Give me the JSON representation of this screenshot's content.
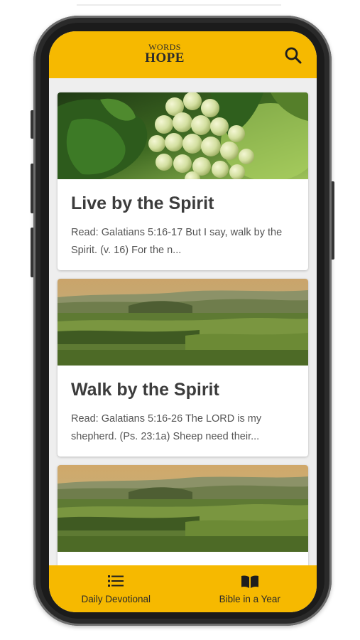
{
  "app": {
    "logo_top": "WORDS",
    "logo_bottom": "HOPE",
    "brand_color": "#f6b900"
  },
  "header": {
    "search_icon": "search-icon"
  },
  "devotionals": [
    {
      "image": "grapes-vine-photo",
      "title": "Live by the Spirit",
      "excerpt": "Read: Galatians 5:16-17 But I say, walk by the Spirit. (v. 16) For the n..."
    },
    {
      "image": "green-landscape-photo",
      "title": "Walk by the Spirit",
      "excerpt": "Read: Galatians 5:16-26 The LORD is my shepherd. (Ps. 23:1a) Sheep need their..."
    },
    {
      "image": "green-landscape-photo"
    }
  ],
  "bottom_nav": {
    "items": [
      {
        "label": "Daily Devotional",
        "icon": "list-icon"
      },
      {
        "label": "Bible in a Year",
        "icon": "book-icon"
      }
    ]
  }
}
